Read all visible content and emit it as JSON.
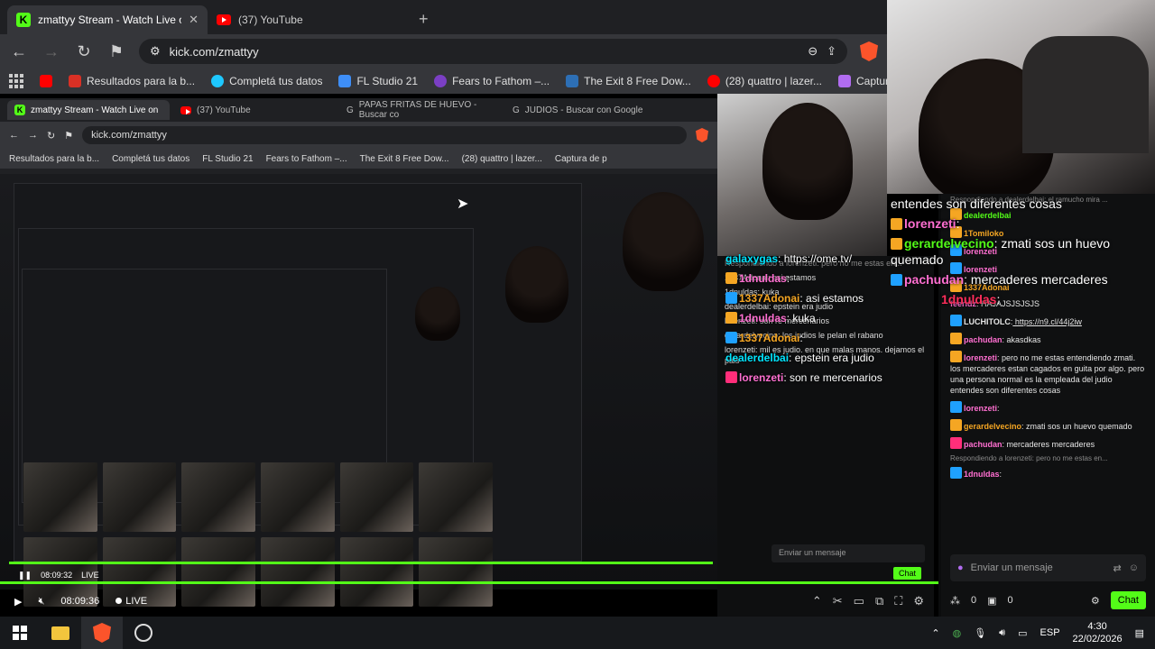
{
  "browser": {
    "tabs": [
      {
        "title": "zmattyy Stream - Watch Live on",
        "icon": "kick-favicon",
        "active": true
      },
      {
        "title": "(37) YouTube",
        "icon": "youtube-favicon",
        "active": false
      }
    ],
    "url": "kick.com/zmattyy",
    "bookmarks": [
      {
        "label": "",
        "icon": "youtube-icon"
      },
      {
        "label": "Resultados para la b...",
        "icon": "google-icon"
      },
      {
        "label": "Completá tus datos",
        "icon": "circle-icon"
      },
      {
        "label": "FL Studio 21",
        "icon": "fl-icon"
      },
      {
        "label": "Fears to Fathom –...",
        "icon": "purple-icon"
      },
      {
        "label": "The Exit 8 Free Dow...",
        "icon": "game-icon"
      },
      {
        "label": "(28) quattro | lazer...",
        "icon": "youtube-icon"
      },
      {
        "label": "Captura de p",
        "icon": "feather-icon"
      }
    ]
  },
  "nested": {
    "tabs": [
      {
        "title": "zmattyy Stream - Watch Live on"
      },
      {
        "title": "(37) YouTube"
      },
      {
        "title": "PAPAS FRITAS DE HUEVO - Buscar co"
      },
      {
        "title": "JUDIOS - Buscar con Google"
      }
    ],
    "url": "kick.com/zmattyy",
    "bookmarks": [
      "Resultados para la b...",
      "Completá tus datos",
      "FL Studio 21",
      "Fears to Fathom –...",
      "The Exit 8 Free Dow...",
      "(28) quattro | lazer...",
      "Captura de p"
    ],
    "time": "08:09:32",
    "live": "LIVE",
    "mid_chat": [
      "Respondiendo a lorenzeti: pero no me estas en...",
      "1337Adonai: asi estamos",
      "1dnuldas: kuka",
      "dealerdelbai: epstein era judio",
      "lorenzeti: son re mercenarios",
      "gerardelvecino: los judios le pelan el rabano",
      "lorenzeti: mil es judio. en que malas manos. dejamos el pais"
    ],
    "mid_input_placeholder": "Enviar un mensaje",
    "mid_chat_button": "Chat"
  },
  "overlay_chat": [
    {
      "user": "",
      "text": "entendes son diferentes cosas"
    },
    {
      "user": "lorenzeti",
      "sep": ":",
      "text": ""
    },
    {
      "user": "gerardelvecino",
      "sep": ":",
      "text": " zmati sos un huevo quemado"
    },
    {
      "user": "pachudan",
      "sep": ":",
      "text": " mercaderes mercaderes"
    },
    {
      "user": "1dnuldas",
      "sep": ":",
      "text": ""
    }
  ],
  "overlay_mid_chat": [
    {
      "user": "galaxygas",
      "text": ": https://ome.tv/"
    },
    {
      "user": "1dnuldas",
      "text": ":"
    },
    {
      "user": "1337Adonai",
      "text": ": asi estamos"
    },
    {
      "user": "1dnuldas",
      "text": ": kuka"
    },
    {
      "user": "1337Adonai",
      "text": ":"
    },
    {
      "user": "dealerdelbai",
      "text": ": epstein era judio"
    },
    {
      "user": "lorenzeti",
      "text": ": son re mercenarios"
    }
  ],
  "right_chat": {
    "messages": [
      {
        "reply": "Respondiendo a dealerdelbai: el ramucho mira ..."
      },
      {
        "user": "dealerdelbai",
        "text": ""
      },
      {
        "user": "1Tomiloko",
        "text": ""
      },
      {
        "user": "lorenzeti",
        "text": ""
      },
      {
        "user": "lorenzeti",
        "text": ""
      },
      {
        "user": "1337Adonai",
        "text": ""
      },
      {
        "user": "feeridz",
        "text": " HAJAJSJSJSJS"
      },
      {
        "user": "LUCHITOLC",
        "text": " https://n9.cl/44j2iw"
      },
      {
        "user": "pachudan",
        "text": " akasdkas"
      },
      {
        "user": "lorenzeti",
        "text": " pero no me estas entendiendo zmati. los mercaderes estan cagados en guita por algo. pero una persona normal es la empleada del judio entendes son diferentes cosas"
      },
      {
        "user": "lorenzeti",
        "text": ""
      },
      {
        "user": "gerardelvecino",
        "text": " zmati sos un huevo quemado"
      },
      {
        "user": "pachudan",
        "text": " mercaderes mercaderes"
      },
      {
        "reply": "Respondiendo a lorenzeti: pero no me estas en..."
      },
      {
        "user": "1dnuldas",
        "text": ""
      }
    ],
    "input_placeholder": "Enviar un mensaje",
    "viewers": "0",
    "gifts": "0",
    "chat_button": "Chat"
  },
  "player": {
    "time": "08:09:36",
    "live": "LIVE"
  },
  "taskbar": {
    "language": "ESP",
    "time": "4:30",
    "date": "22/02/2026"
  }
}
